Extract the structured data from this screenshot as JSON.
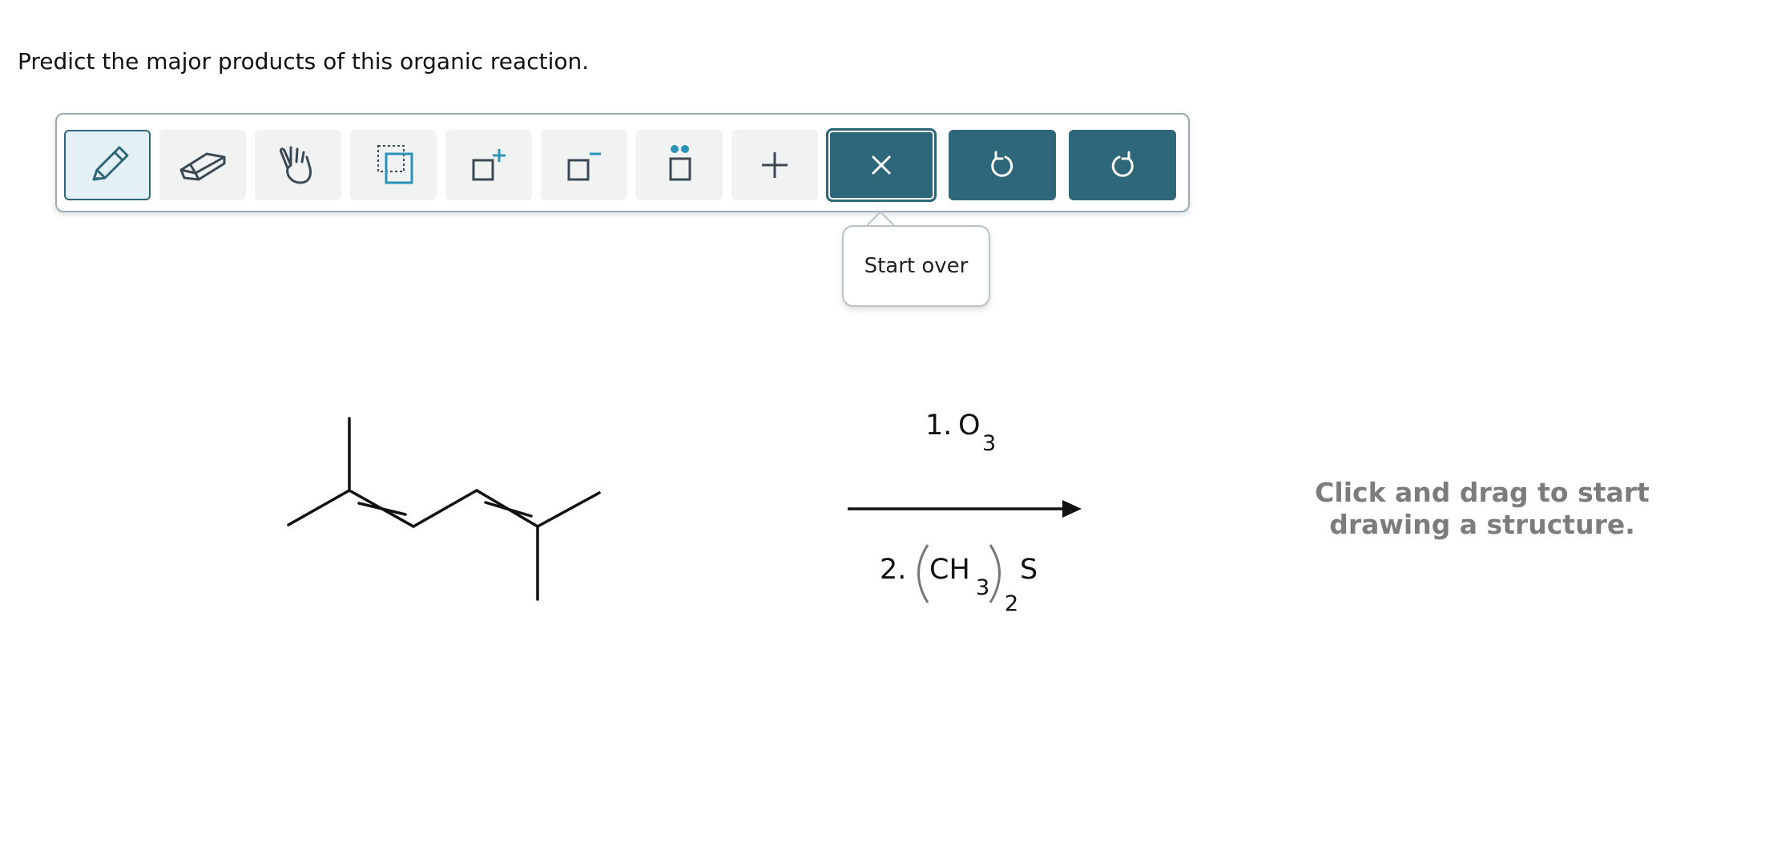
{
  "question": "Predict the major products of this organic reaction.",
  "toolbar": {
    "tools": [
      {
        "name": "draw-tool",
        "icon": "pencil-icon",
        "active": true
      },
      {
        "name": "erase-tool",
        "icon": "eraser-icon"
      },
      {
        "name": "move-tool",
        "icon": "hand-icon"
      },
      {
        "name": "select-tool",
        "icon": "selection-box-icon"
      },
      {
        "name": "increase-charge-tool",
        "icon": "positive-charge-icon"
      },
      {
        "name": "decrease-charge-tool",
        "icon": "negative-charge-icon"
      },
      {
        "name": "lone-pair-tool",
        "icon": "lone-pair-icon"
      },
      {
        "name": "add-tool",
        "icon": "plus-icon"
      }
    ],
    "actions": [
      {
        "name": "start-over-button",
        "icon": "close-icon"
      },
      {
        "name": "undo-button",
        "icon": "undo-icon"
      },
      {
        "name": "redo-button",
        "icon": "redo-icon"
      }
    ],
    "accent_color": "#2e6779"
  },
  "tooltip": {
    "text": "Start over"
  },
  "reaction": {
    "step1_num": "1.",
    "step1_reagent": "O",
    "step1_sub": "3",
    "step2_num": "2.",
    "step2_reagent": "CH",
    "step2_sub_inner": "3",
    "step2_sub_outer": "2",
    "step2_tail": "S"
  },
  "hint": {
    "line1": "Click and drag to start",
    "line2": "drawing a structure."
  }
}
